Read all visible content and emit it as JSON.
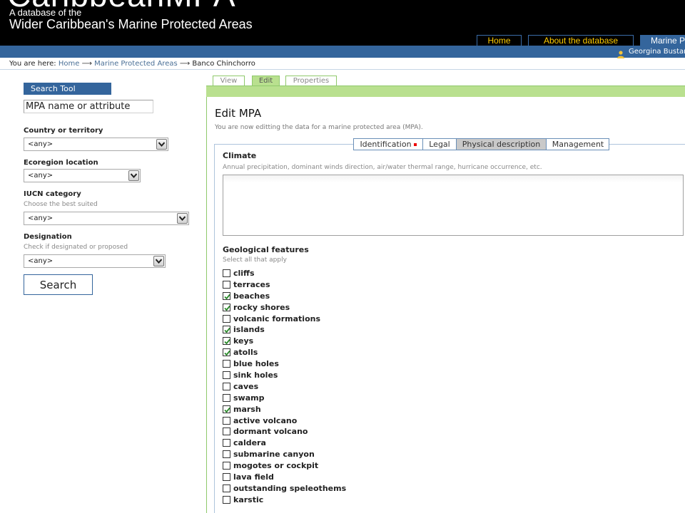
{
  "header": {
    "site_title": "CaribbeanMPA",
    "tagline_line1": "A database of the",
    "tagline_line2": "Wider Caribbean's Marine Protected Areas"
  },
  "nav": [
    {
      "label": "Home",
      "active": false
    },
    {
      "label": "About the database",
      "active": false
    },
    {
      "label": "Marine Protected Areas",
      "active": true
    }
  ],
  "user": {
    "name": "Georgina Bustamante"
  },
  "breadcrumb": {
    "prefix": "You are here:",
    "items": [
      "Home",
      "Marine Protected Areas",
      "Banco Chinchorro"
    ],
    "separator": "⟶"
  },
  "sidebar": {
    "title": "Search Tool",
    "search_placeholder": "MPA name or attribute",
    "filters": [
      {
        "label": "Country or territory",
        "hint": "",
        "value": "<any>"
      },
      {
        "label": "Ecoregion location",
        "hint": "",
        "value": "<any>"
      },
      {
        "label": "IUCN category",
        "hint": "Choose the best suited",
        "value": "<any>"
      },
      {
        "label": "Designation",
        "hint": "Check if designated or proposed",
        "value": "<any>"
      }
    ],
    "search_button": "Search"
  },
  "main_tabs": [
    {
      "label": "View",
      "active": false
    },
    {
      "label": "Edit",
      "active": true
    },
    {
      "label": "Properties",
      "active": false
    }
  ],
  "edit": {
    "title": "Edit MPA",
    "description": "You are now editting the data for a marine protected area (MPA).",
    "section_tabs": [
      {
        "label": "Identification",
        "required": true,
        "active": false
      },
      {
        "label": "Legal",
        "required": false,
        "active": false
      },
      {
        "label": "Physical description",
        "required": false,
        "active": true
      },
      {
        "label": "Management",
        "required": false,
        "active": false
      }
    ],
    "climate": {
      "label": "Climate",
      "hint": "Annual precipitation, dominant winds direction, air/water thermal range, hurricane occurrence, etc.",
      "value": ""
    },
    "geological": {
      "label": "Geological features",
      "hint": "Select all that apply",
      "options": [
        {
          "label": "cliffs",
          "checked": false
        },
        {
          "label": "terraces",
          "checked": false
        },
        {
          "label": "beaches",
          "checked": true
        },
        {
          "label": "rocky shores",
          "checked": true
        },
        {
          "label": "volcanic formations",
          "checked": false
        },
        {
          "label": "islands",
          "checked": true
        },
        {
          "label": "keys",
          "checked": true
        },
        {
          "label": "atolls",
          "checked": true
        },
        {
          "label": "blue holes",
          "checked": false
        },
        {
          "label": "sink holes",
          "checked": false
        },
        {
          "label": "caves",
          "checked": false
        },
        {
          "label": "swamp",
          "checked": false
        },
        {
          "label": "marsh",
          "checked": true
        },
        {
          "label": "active volcano",
          "checked": false
        },
        {
          "label": "dormant volcano",
          "checked": false
        },
        {
          "label": "caldera",
          "checked": false
        },
        {
          "label": "submarine canyon",
          "checked": false
        },
        {
          "label": "mogotes or cockpit",
          "checked": false
        },
        {
          "label": "lava field",
          "checked": false
        },
        {
          "label": "outstanding speleothems",
          "checked": false
        },
        {
          "label": "karstic",
          "checked": false
        }
      ]
    }
  },
  "colors": {
    "header_bg": "#000000",
    "nav_text": "#ffcc00",
    "brand_blue": "#34659c",
    "edit_green": "#b9e08f"
  }
}
